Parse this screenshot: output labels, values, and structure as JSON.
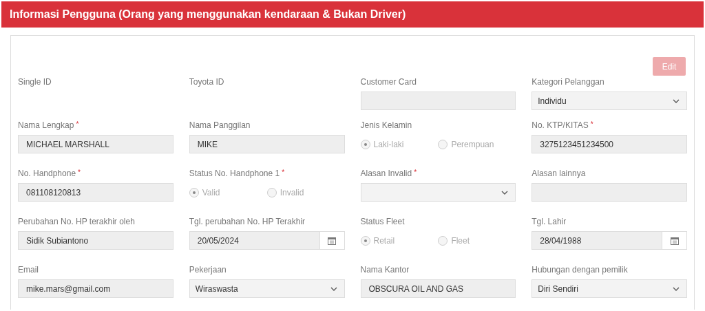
{
  "header": {
    "title": "Informasi Pengguna (Orang yang menggunakan kendaraan & Bukan Driver)"
  },
  "edit_button": {
    "label": "Edit",
    "disabled": true
  },
  "fields": [
    {
      "kind": "empty",
      "label": "Single ID"
    },
    {
      "kind": "empty",
      "label": "Toyota ID"
    },
    {
      "kind": "text",
      "label": "Customer Card"
    },
    {
      "kind": "select",
      "label": "Kategori Pelanggan",
      "value": "Individu"
    },
    {
      "kind": "text",
      "label": "Nama Lengkap",
      "required_mark": "*",
      "value": "MICHAEL MARSHALL"
    },
    {
      "kind": "text",
      "label": "Nama Panggilan",
      "value": "MIKE"
    },
    {
      "kind": "radio",
      "label": "Jenis Kelamin",
      "options": [
        {
          "label": "Laki-laki",
          "selected": true
        },
        {
          "label": "Perempuan",
          "selected": false
        }
      ]
    },
    {
      "kind": "text",
      "label": "No. KTP/KITAS",
      "required_mark": "*",
      "value": "3275123451234500"
    },
    {
      "kind": "text",
      "label": "No. Handphone",
      "required_mark": "*",
      "value": "081108120813"
    },
    {
      "kind": "radio",
      "label": "Status No. Handphone 1",
      "required_mark": "*",
      "options": [
        {
          "label": "Valid",
          "selected": true
        },
        {
          "label": "Invalid",
          "selected": false
        }
      ]
    },
    {
      "kind": "select",
      "label": "Alasan Invalid",
      "required_mark": "*"
    },
    {
      "kind": "text",
      "label": "Alasan lainnya"
    },
    {
      "kind": "text",
      "label": "Perubahan No. HP terakhir oleh",
      "value": "Sidik Subiantono"
    },
    {
      "kind": "date",
      "label": "Tgl. perubahan No. HP Terakhir",
      "value": "20/05/2024"
    },
    {
      "kind": "radio",
      "label": "Status Fleet",
      "options": [
        {
          "label": "Retail",
          "selected": true
        },
        {
          "label": "Fleet",
          "selected": false
        }
      ]
    },
    {
      "kind": "date",
      "label": "Tgl. Lahir",
      "value": "28/04/1988"
    },
    {
      "kind": "text",
      "label": "Email",
      "value": "mike.mars@gmail.com"
    },
    {
      "kind": "select",
      "label": "Pekerjaan",
      "value": "Wiraswasta"
    },
    {
      "kind": "text",
      "label": "Nama Kantor",
      "value": "OBSCURA OIL AND GAS"
    },
    {
      "kind": "select",
      "label": "Hubungan dengan pemilik",
      "value": "Diri Sendiri"
    }
  ]
}
